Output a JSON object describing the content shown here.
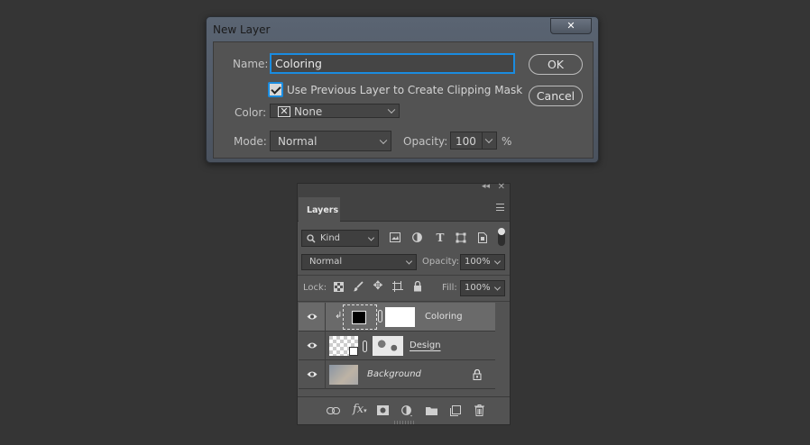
{
  "dialog": {
    "title": "New Layer",
    "close_glyph": "✕",
    "name_label": "Name:",
    "name_value": "Coloring",
    "clip_checked": true,
    "clip_label": "Use Previous Layer to Create Clipping Mask",
    "color_label": "Color:",
    "color_value": "None",
    "mode_label": "Mode:",
    "mode_value": "Normal",
    "opacity_label": "Opacity:",
    "opacity_value": "100",
    "opacity_unit": "%",
    "ok_label": "OK",
    "cancel_label": "Cancel"
  },
  "layers_panel": {
    "tab_label": "Layers",
    "filter_kind": "Kind",
    "blend_mode": "Normal",
    "opacity_label": "Opacity:",
    "opacity_value": "100%",
    "lock_label": "Lock:",
    "fill_label": "Fill:",
    "fill_value": "100%",
    "layers": [
      {
        "name": "Coloring",
        "selected": true,
        "clipped": true
      },
      {
        "name": "Design",
        "selected": false,
        "underlined": true
      },
      {
        "name": "Background",
        "selected": false,
        "italic": true,
        "locked": true
      }
    ]
  },
  "colors": {
    "accent": "#1a8ce0",
    "canvas": "#353535",
    "panel": "#535353"
  }
}
